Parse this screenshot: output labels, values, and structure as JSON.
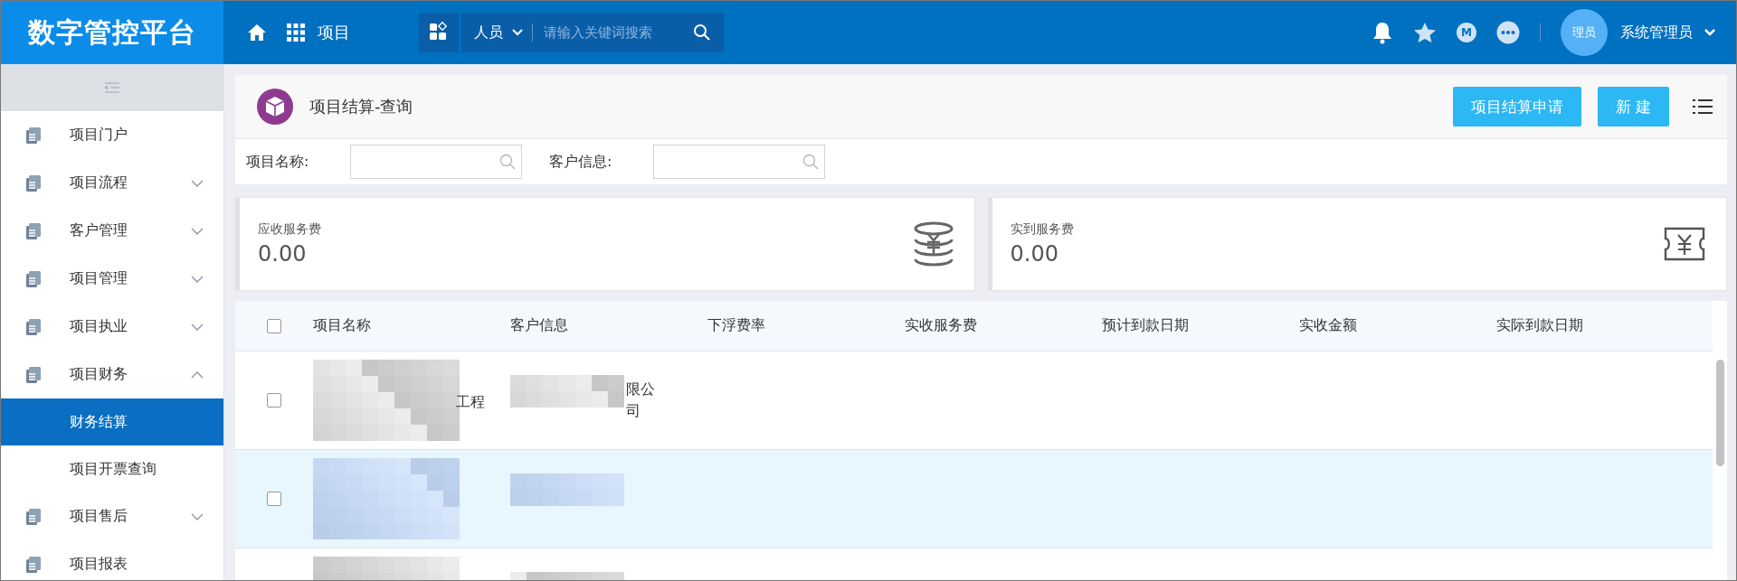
{
  "app": {
    "logo": "数字管控平台"
  },
  "topnav": {
    "module": "项目"
  },
  "search": {
    "category": "人员",
    "placeholder": "请输入关键词搜索"
  },
  "user": {
    "avatar": "理员",
    "name": "系统管理员",
    "badge_letter": "M"
  },
  "sidebar": {
    "items": [
      {
        "label": "项目门户",
        "kind": "link"
      },
      {
        "label": "项目流程",
        "kind": "group",
        "expanded": false
      },
      {
        "label": "客户管理",
        "kind": "group",
        "expanded": false
      },
      {
        "label": "项目管理",
        "kind": "group",
        "expanded": false
      },
      {
        "label": "项目执业",
        "kind": "group",
        "expanded": false
      },
      {
        "label": "项目财务",
        "kind": "group",
        "expanded": true,
        "children": [
          {
            "label": "财务结算",
            "selected": true
          },
          {
            "label": "项目开票查询",
            "selected": false
          }
        ]
      },
      {
        "label": "项目售后",
        "kind": "group",
        "expanded": false
      },
      {
        "label": "项目报表",
        "kind": "link"
      }
    ]
  },
  "page": {
    "title": "项目结算-查询",
    "buttons": [
      "项目结算申请",
      "新 建"
    ]
  },
  "filters": [
    {
      "label": "项目名称:"
    },
    {
      "label": "客户信息:"
    }
  ],
  "cards": [
    {
      "label": "应收服务费",
      "value": "0.00",
      "kind": "coins"
    },
    {
      "label": "实到服务费",
      "value": "0.00",
      "kind": "ticket"
    }
  ],
  "table": {
    "header_checked": false,
    "columns": [
      "项目名称",
      "客户信息",
      "下浮费率",
      "实收服务费",
      "预计到款日期",
      "实收金额",
      "实际到款日期"
    ],
    "rows": [
      {
        "checked": false,
        "selected": false,
        "name": "工程",
        "customer": [
          "限公",
          "司"
        ]
      },
      {
        "checked": false,
        "selected": true
      },
      {
        "selected": false
      }
    ]
  }
}
